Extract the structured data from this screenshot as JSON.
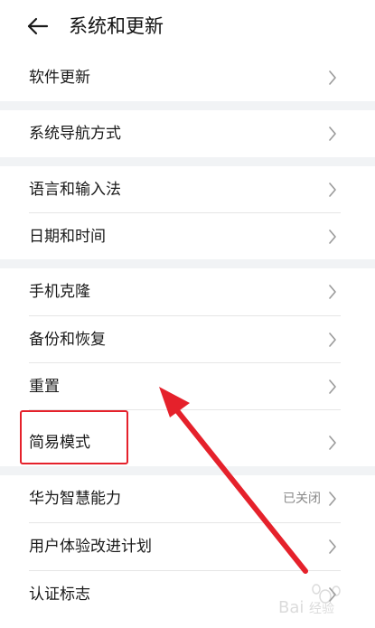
{
  "header": {
    "title": "系统和更新"
  },
  "items": [
    {
      "label": "软件更新",
      "value": ""
    },
    {
      "label": "系统导航方式",
      "value": ""
    },
    {
      "label": "语言和输入法",
      "value": ""
    },
    {
      "label": "日期和时间",
      "value": ""
    },
    {
      "label": "手机克隆",
      "value": ""
    },
    {
      "label": "备份和恢复",
      "value": ""
    },
    {
      "label": "重置",
      "value": ""
    },
    {
      "label": "简易模式",
      "value": ""
    },
    {
      "label": "华为智慧能力",
      "value": "已关闭"
    },
    {
      "label": "用户体验改进计划",
      "value": ""
    },
    {
      "label": "认证标志",
      "value": ""
    }
  ],
  "colors": {
    "annotation_red": "#e5212b",
    "section_gap": "#f1f3f5"
  },
  "watermark": {
    "text": "Bai 经验"
  },
  "icons": {
    "back": "arrow-left-icon",
    "chevron": "chevron-right-icon"
  }
}
